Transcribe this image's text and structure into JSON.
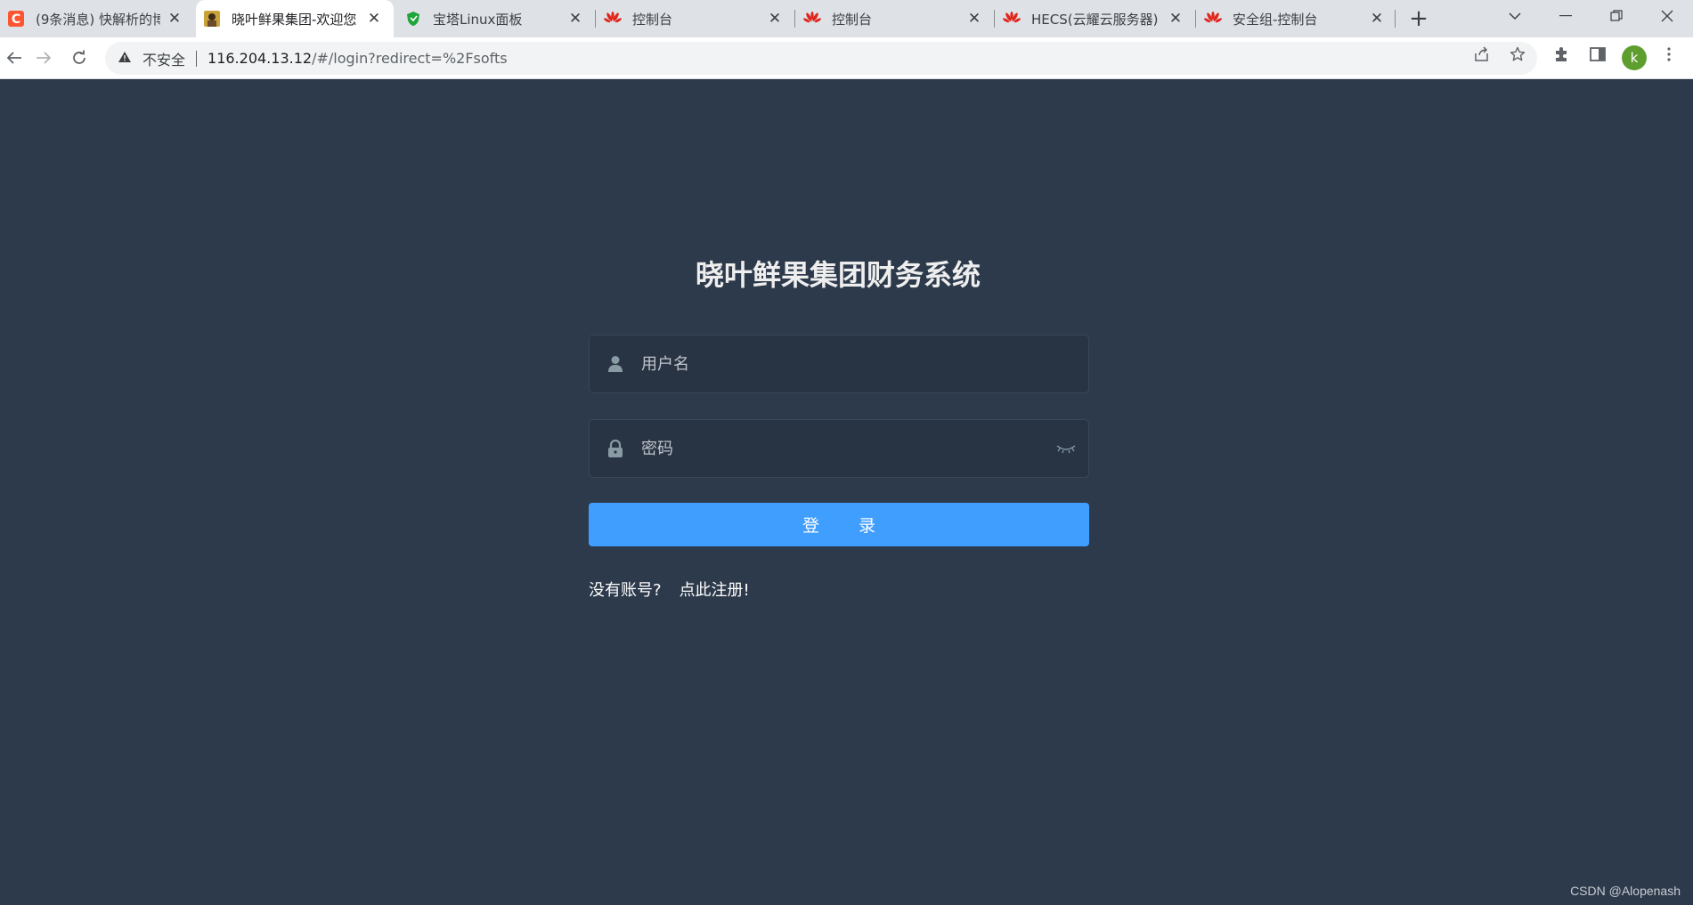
{
  "browser": {
    "tabs": [
      {
        "title": "(9条消息) 快解析的博",
        "icon": "csdn-icon",
        "active": false
      },
      {
        "title": "晓叶鲜果集团-欢迎您",
        "icon": "avatar-favicon",
        "active": true
      },
      {
        "title": "宝塔Linux面板",
        "icon": "baota-shield-icon",
        "active": false
      },
      {
        "title": "控制台",
        "icon": "huawei-icon",
        "active": false
      },
      {
        "title": "控制台",
        "icon": "huawei-icon",
        "active": false
      },
      {
        "title": "HECS(云耀云服务器)",
        "icon": "huawei-icon",
        "active": false
      },
      {
        "title": "安全组-控制台",
        "icon": "huawei-icon",
        "active": false
      }
    ],
    "address": {
      "security_label": "不安全",
      "host": "116.204.13.12",
      "path": "/#/login?redirect=%2Fsofts"
    },
    "profile_initial": "k",
    "colors": {
      "tabstrip": "#dee1e6",
      "huawei_red": "#e1251b",
      "csdn_orange": "#fc5531",
      "profile": "#5e9e2f"
    }
  },
  "login": {
    "title": "晓叶鲜果集团财务系统",
    "username_placeholder": "用户名",
    "password_placeholder": "密码",
    "submit_label": "登录",
    "register_prompt": "没有账号?",
    "register_link": "点此注册!",
    "colors": {
      "background": "#2d3a4b",
      "button": "#409eff"
    }
  },
  "watermark": "CSDN @Alopenash"
}
